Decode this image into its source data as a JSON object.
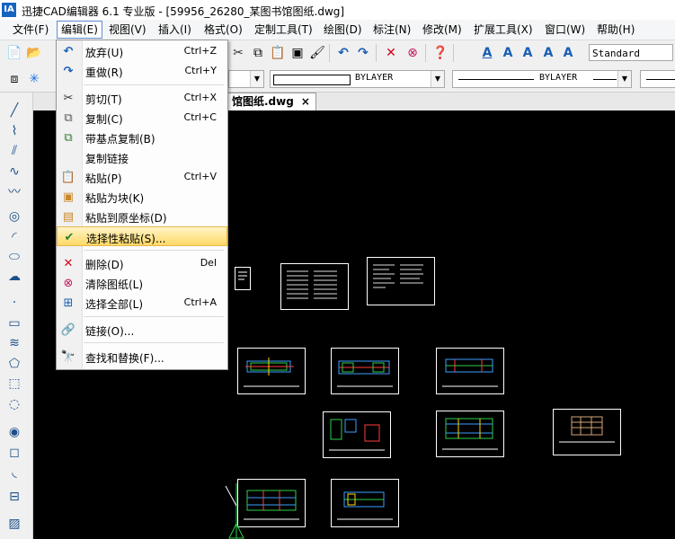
{
  "window": {
    "title": "迅捷CAD编辑器 6.1 专业版  - [59956_26280_某图书馆图纸.dwg]",
    "logo_icon": "app-logo-icon",
    "logo_text": "IA"
  },
  "menubar": {
    "items": [
      {
        "label": "文件(F)"
      },
      {
        "label": "编辑(E)"
      },
      {
        "label": "视图(V)"
      },
      {
        "label": "插入(I)"
      },
      {
        "label": "格式(O)"
      },
      {
        "label": "定制工具(T)"
      },
      {
        "label": "绘图(D)"
      },
      {
        "label": "标注(N)"
      },
      {
        "label": "修改(M)"
      },
      {
        "label": "扩展工具(X)"
      },
      {
        "label": "窗口(W)"
      },
      {
        "label": "帮助(H)"
      }
    ]
  },
  "toolbar": {
    "text_style": "Standard",
    "color_combo": "BYLAYER",
    "linetype_combo": "BYLAYER"
  },
  "tab": {
    "label": "馆图纸.dwg",
    "close": "×"
  },
  "edit_menu": {
    "items": [
      {
        "label": "放弃(U)",
        "shortcut": "Ctrl+Z",
        "icon": "undo-icon"
      },
      {
        "label": "重做(R)",
        "shortcut": "Ctrl+Y",
        "icon": "redo-icon"
      },
      {
        "label": "剪切(T)",
        "shortcut": "Ctrl+X",
        "icon": "scissors-icon"
      },
      {
        "label": "复制(C)",
        "shortcut": "Ctrl+C",
        "icon": "copy-icon"
      },
      {
        "label": "带基点复制(B)",
        "shortcut": "",
        "icon": "copy-base-icon"
      },
      {
        "label": "复制链接",
        "shortcut": "",
        "icon": "copy-link-icon"
      },
      {
        "label": "粘贴(P)",
        "shortcut": "Ctrl+V",
        "icon": "paste-icon"
      },
      {
        "label": "粘贴为块(K)",
        "shortcut": "",
        "icon": "paste-block-icon"
      },
      {
        "label": "粘贴到原坐标(D)",
        "shortcut": "",
        "icon": "paste-orig-icon"
      },
      {
        "label": "选择性粘贴(S)...",
        "shortcut": "",
        "icon": "paste-special-icon"
      },
      {
        "label": "删除(D)",
        "shortcut": "Del",
        "icon": "delete-icon"
      },
      {
        "label": "清除图纸(L)",
        "shortcut": "",
        "icon": "purge-icon"
      },
      {
        "label": "选择全部(L)",
        "shortcut": "Ctrl+A",
        "icon": "select-all-icon"
      },
      {
        "label": "链接(O)...",
        "shortcut": "",
        "icon": "link-icon"
      },
      {
        "label": "查找和替换(F)...",
        "shortcut": "",
        "icon": "find-replace-icon"
      }
    ]
  }
}
